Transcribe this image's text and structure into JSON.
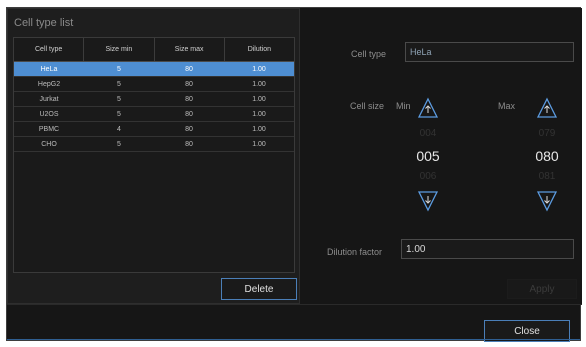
{
  "left_panel": {
    "title": "Cell type list",
    "columns": [
      "Cell type",
      "Size min",
      "Size max",
      "Dilution"
    ],
    "rows": [
      {
        "cell_type": "HeLa",
        "size_min": "5",
        "size_max": "80",
        "dilution": "1.00",
        "selected": true
      },
      {
        "cell_type": "HepG2",
        "size_min": "5",
        "size_max": "80",
        "dilution": "1.00",
        "selected": false
      },
      {
        "cell_type": "Jurkat",
        "size_min": "5",
        "size_max": "80",
        "dilution": "1.00",
        "selected": false
      },
      {
        "cell_type": "U2OS",
        "size_min": "5",
        "size_max": "80",
        "dilution": "1.00",
        "selected": false
      },
      {
        "cell_type": "PBMC",
        "size_min": "4",
        "size_max": "80",
        "dilution": "1.00",
        "selected": false
      },
      {
        "cell_type": "CHO",
        "size_min": "5",
        "size_max": "80",
        "dilution": "1.00",
        "selected": false
      }
    ],
    "delete_label": "Delete"
  },
  "right_panel": {
    "cell_type_label": "Cell type",
    "cell_type_value": "HeLa",
    "cell_size_label": "Cell size",
    "min_label": "Min",
    "max_label": "Max",
    "min": {
      "prev": "004",
      "current": "005",
      "next": "006"
    },
    "max": {
      "prev": "079",
      "current": "080",
      "next": "081"
    },
    "dilution_label": "Dilution factor",
    "dilution_value": "1.00",
    "apply_label": "Apply"
  },
  "footer": {
    "close_label": "Close"
  },
  "icons": {
    "increment": "up-triangle-icon",
    "decrement": "down-triangle-icon"
  },
  "colors": {
    "accent": "#4e8ed2",
    "background": "#161616",
    "panel": "#1e1e1e"
  }
}
